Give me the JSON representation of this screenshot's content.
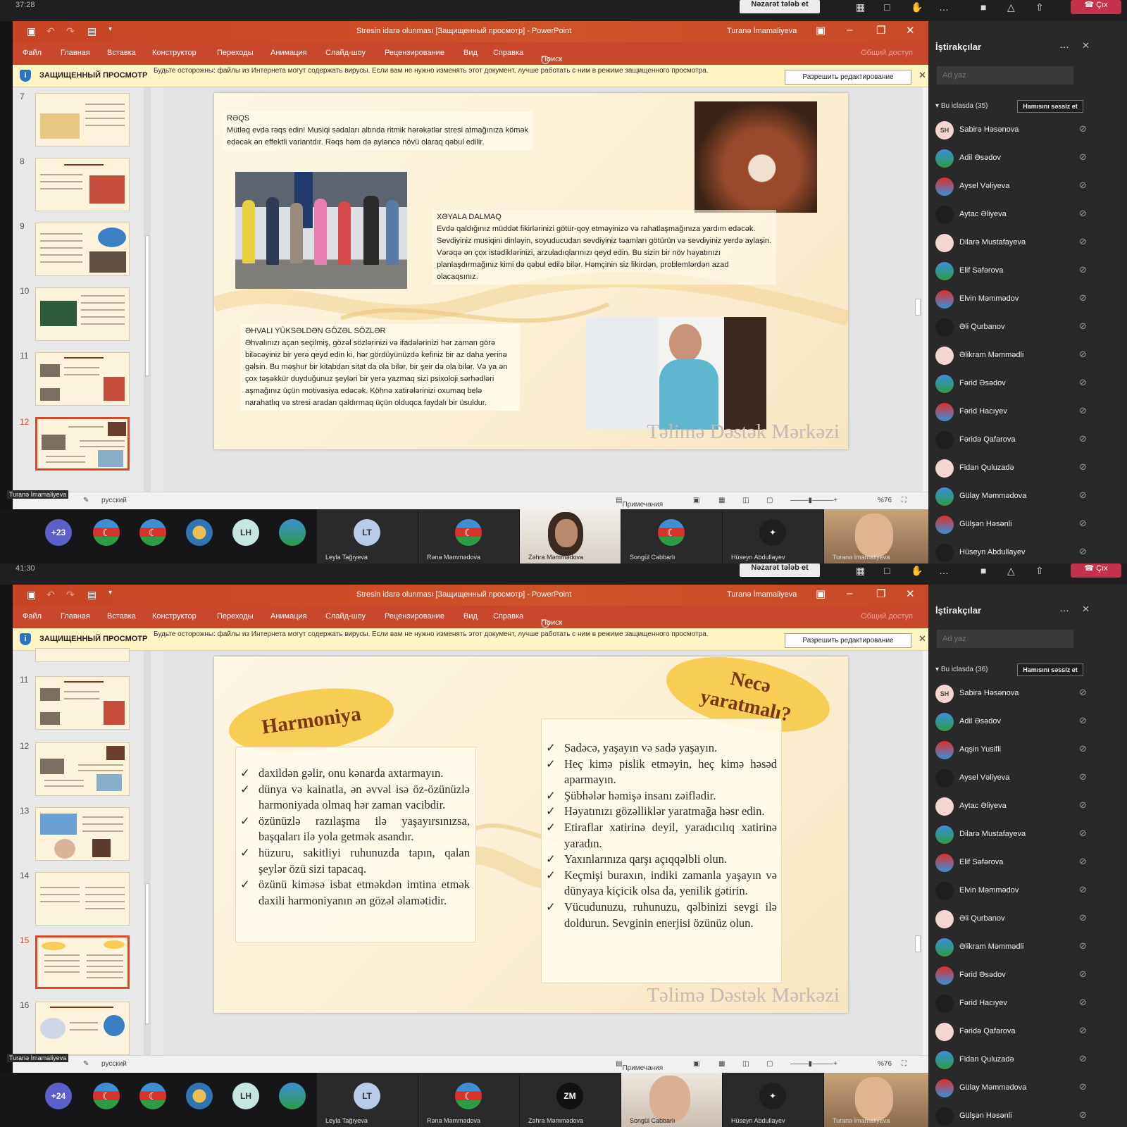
{
  "teams": {
    "request_control": "Nəzarət tələb et",
    "leave": "Çıx",
    "timers": [
      "37:28",
      "41:30"
    ]
  },
  "ppt": {
    "title": "Stresin idarə olunması [Защищенный просмотр] - PowerPoint",
    "user": "Turanə İmamaliyeva",
    "share": "Общий доступ",
    "tabs": [
      "Файл",
      "Главная",
      "Вставка",
      "Конструктор",
      "Переходы",
      "Анимация",
      "Слайд-шоу",
      "Рецензирование",
      "Вид",
      "Справка",
      "Поиск"
    ],
    "protected_label": "ЗАЩИЩЕННЫЙ ПРОСМОТР",
    "protected_msg": "Будьте осторожны: файлы из Интернета могут содержать вирусы. Если вам не нужно изменять этот документ, лучше работать с ним в режиме защищенного просмотра.",
    "enable_edit": "Разрешить редактирование",
    "lang": "русский",
    "notes": "Примечания",
    "zoom": "%76",
    "presenter_tag": "Turanə İmamaliyeva"
  },
  "frames": [
    {
      "thumb_numbers": [
        "7",
        "8",
        "9",
        "10",
        "11",
        "12"
      ],
      "selected_thumb": "12",
      "participants_count": "Bu iclasda (35)",
      "extra_count": "+23"
    },
    {
      "thumb_numbers": [
        "11",
        "12",
        "13",
        "14",
        "15",
        "16"
      ],
      "selected_thumb": "15",
      "participants_count": "Bu iclasda (36)",
      "extra_count": "+24"
    }
  ],
  "slide12": {
    "raqs_head": "RƏQS",
    "raqs_body": "Mütləq evdə rəqs edin! Musiqi sədaları altında ritmik hərəkətlər stresi atmağınıza kömək edəcək ən effektli variantdır. Rəqs həm də ayləncə növü olaraq qəbul edilir.",
    "dream_head": "XƏYALA DALMAQ",
    "dream_body": "Evdə qaldığınız müddət fikirlərinizi götür-qoy etməyinizə və rahatlaşmağınıza yardım edəcək. Sevdiyiniz musiqini dinləyin, soyuducudan sevdiyiniz təamları götürün və sevdiyiniz yerdə aylaşin. Vərəqə ən çox istədiklərinizi, arzuladıqlarınızı qeyd edin. Bu sizin bir növ həyatınızı planlaşdırmağınız kimi də qəbul edilə bilər. Həmçinin siz fikirdən, problemlərdən azad olacaqsınız.",
    "mood_head": "ƏHVALI YÜKSƏLDƏN GÖZƏL SÖZLƏR",
    "mood_body": "Əhvalınızı açan seçilmiş, gözəl sözlərinizi və ifadələrinizi hər zaman görə biləcəyiniz bir yerə qeyd edin ki, hər gördüyünüzdə kefiniz bir az daha yerinə gəlsin. Bu məşhur bir kitabdan sitat da ola bilər, bir şeir də ola bilər. Və ya ən çox təşəkkür duyduğunuz şeyləri bir yerə yazmaq sizi psixoloji sərhədləri aşmağınız üçün motivasiya edəcək. Köhnə xatirələrinizi oxumaq belə narahatlıq və stresi aradan qaldırmaq üçün olduqca faydalı bir üsuldur.",
    "watermark": "Təlimə Dəstək Mərkəzi"
  },
  "slide15": {
    "left_title": "Harmoniya",
    "right_title_1": "Necə",
    "right_title_2": "yaratmalı?",
    "left_items": [
      "daxildən gəlir, onu kənarda axtarmayın.",
      "dünya və kainatla, ən əvvəl isə öz-özünüzlə harmoniyada olmaq hər zaman vacibdir.",
      "özünüzlə razılaşma ilə yaşayırsınızsa, başqaları ilə yola getmək asandır.",
      "hüzuru, sakitliyi ruhunuzda tapın, qalan şeylər özü sizi tapacaq.",
      "özünü kiməsə isbat etməkdən imtina etmək daxili harmoniyanın ən gözəl əlamətidir."
    ],
    "right_items": [
      "Sadəcə, yaşayın və sadə yaşayın.",
      "Heç kimə pislik etməyin, heç kimə həsəd aparmayın.",
      "Şübhələr həmişə insanı zəiflədir.",
      "Həyatınızı gözəlliklər yaratmağa həsr edin.",
      "Etiraflar xatirinə deyil, yaradıcılıq xatirinə yaradın.",
      "Yaxınlarınıza qarşı açıqqəlbli olun.",
      "Keçmişi buraxın, indiki zamanla yaşayın və dünyaya kiçicik olsa da, yenilik gətirin.",
      "Vücudunuzu, ruhunuzu, qəlbinizi sevgi ilə doldurun. Sevginin enerjisi özünüz olun."
    ],
    "watermark": "Təlimə Dəstək Mərkəzi"
  },
  "participants": {
    "title": "İştirakçılar",
    "search_placeholder": "Ad yaz",
    "mute_all": "Hamısını səssiz et",
    "list_a": [
      "Sabirə Həsənova",
      "Adil Əsədov",
      "Aysel Vəliyeva",
      "Aytac Əliyeva",
      "Dilarə Mustafayeva",
      "Elif Səfərova",
      "Elvin Məmmədov",
      "Əli Qurbanov",
      "Əlikram Məmmədli",
      "Fərid Əsədov",
      "Fərid Hacıyev",
      "Fəridə Qafarova",
      "Fidan Quluzadə",
      "Gülay Məmmədova",
      "Gülşən Həsənli",
      "Hüseyn Abdullayev"
    ],
    "list_b": [
      "Sabirə Həsənova",
      "Adil Əsədov",
      "Aqşin Yusifli",
      "Aysel Vəliyeva",
      "Aytac Əliyeva",
      "Dilarə Mustafayeva",
      "Elif Səfərova",
      "Elvin Məmmədov",
      "Əli Qurbanov",
      "Əlikram Məmmədli",
      "Fərid Əsədov",
      "Fərid Hacıyev",
      "Fəridə Qafarova",
      "Fidan Quluzadə",
      "Gülay Məmmədova",
      "Gülşən Həsənli"
    ]
  },
  "strip": {
    "avatars": [
      "LH",
      "LT",
      "ZM"
    ],
    "tiles_a": [
      "Leyla Tağıyeva",
      "Rəna Məmmədova",
      "Zəhra Məmmədova",
      "Songül Cabbarlı",
      "Hüseyn Abdullayev",
      "Turanə İmamaliyeva"
    ],
    "tiles_b": [
      "Leyla Tağıyeva",
      "Rəna Məmmədova",
      "Zəhra Məmmədova",
      "Songül Cabbarlı",
      "Hüseyn Abdullayev",
      "Turanə İmamaliyeva"
    ]
  },
  "colors": {
    "ppt_orange": "#c9472a",
    "teams_dark": "#292929",
    "leave_red": "#c4314b",
    "oval_yellow": "#f7cd55"
  }
}
